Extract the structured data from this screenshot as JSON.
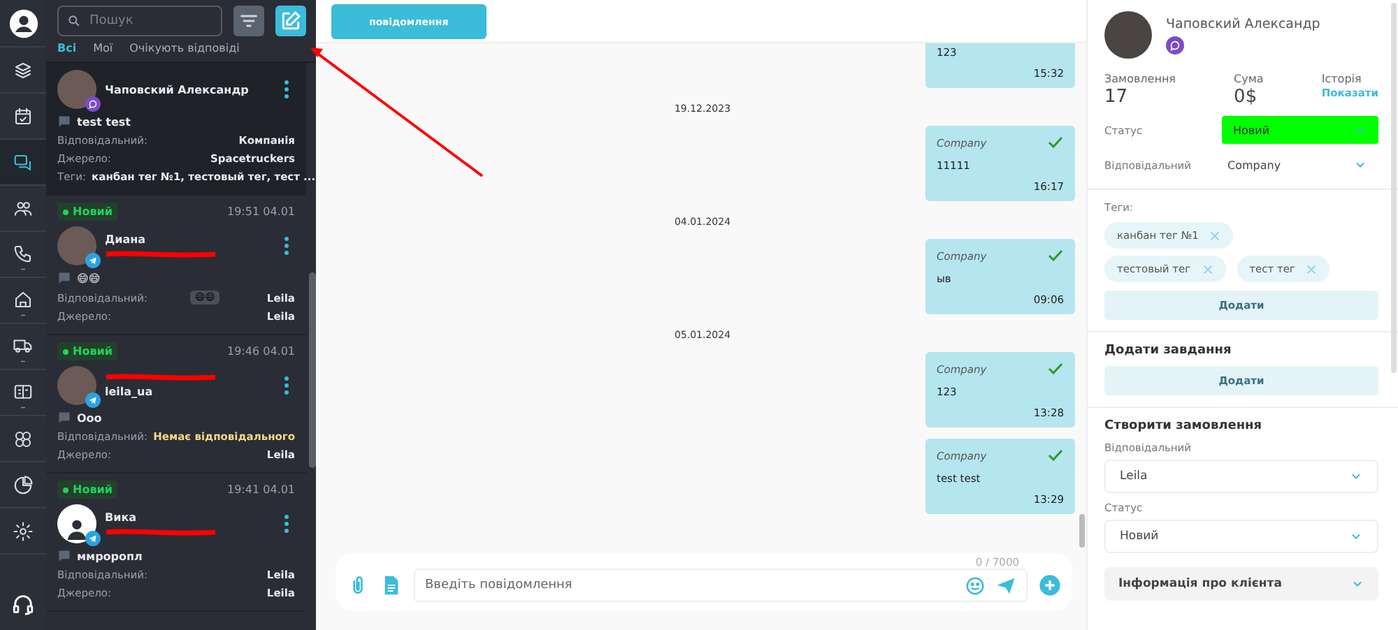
{
  "rail": {
    "items": [
      {
        "selected": false,
        "expandable": false
      },
      {
        "selected": false,
        "expandable": false
      },
      {
        "selected": true,
        "expandable": false
      },
      {
        "selected": false,
        "expandable": false
      },
      {
        "selected": false,
        "expandable": true
      },
      {
        "selected": false,
        "expandable": true
      },
      {
        "selected": false,
        "expandable": true
      },
      {
        "selected": false,
        "expandable": true
      },
      {
        "selected": false,
        "expandable": false
      },
      {
        "selected": false,
        "expandable": false
      },
      {
        "selected": false,
        "expandable": false
      }
    ]
  },
  "search": {
    "placeholder": "Пошук"
  },
  "tabs": [
    {
      "label": "Всі",
      "selected": true
    },
    {
      "label": "Мої",
      "selected": false
    },
    {
      "label": "Очікують відповіді",
      "selected": false
    }
  ],
  "conversations": [
    {
      "selected": true,
      "kind": "viber",
      "name_lines": [
        {
          "kind": "text",
          "text": "Чаповский Александр"
        }
      ],
      "preview": "test test",
      "fields": [
        {
          "label": "Відповідальний:",
          "value": "Компанія",
          "warning": false
        },
        {
          "label": "Джерело:",
          "value": "Spacetruckers",
          "warning": false
        },
        {
          "label": "Теги:",
          "value": "канбан тег №1, тестовый тег, тест ...",
          "warning": false
        }
      ]
    },
    {
      "selected": false,
      "kind": "telegram",
      "status": "Новий",
      "time": "19:51 04.01",
      "name_lines": [
        {
          "kind": "text",
          "text": "Диана"
        },
        {
          "kind": "redacted"
        }
      ],
      "preview": "😄😄",
      "fields": [
        {
          "label": "Відповідальний:",
          "badge": "😄😄",
          "value": "Leila",
          "warning": false
        },
        {
          "label": "Джерело:",
          "value": "Leila",
          "warning": false
        }
      ]
    },
    {
      "selected": false,
      "kind": "telegram",
      "status": "Новий",
      "time": "19:46 04.01",
      "name_lines": [
        {
          "kind": "redacted"
        },
        {
          "kind": "text",
          "text": "leila_ua"
        }
      ],
      "preview": "Ооо",
      "fields": [
        {
          "label": "Відповідальний:",
          "value": "Немає відповідального",
          "warning": true
        },
        {
          "label": "Джерело:",
          "value": "Leila",
          "warning": false
        }
      ]
    },
    {
      "selected": false,
      "kind": "telegram",
      "status": "Новий",
      "time": "19:41 04.01",
      "name_lines": [
        {
          "kind": "text",
          "text": "Вика"
        },
        {
          "kind": "redacted"
        }
      ],
      "preview": "ммроропл",
      "fields": [
        {
          "label": "Відповідальний:",
          "value": "Leila",
          "warning": false
        },
        {
          "label": "Джерело:",
          "value": "Leila",
          "warning": false
        }
      ]
    }
  ],
  "chat": {
    "header_button": "повідомлення",
    "items": [
      {
        "kind": "message",
        "text": "123",
        "time": "15:32",
        "delivered": false
      },
      {
        "kind": "date",
        "text": "19.12.2023"
      },
      {
        "kind": "message",
        "sender": "Company",
        "text": "11111",
        "time": "16:17",
        "delivered": true
      },
      {
        "kind": "date",
        "text": "04.01.2024"
      },
      {
        "kind": "message",
        "sender": "Company",
        "text": "ыв",
        "time": "09:06",
        "delivered": true
      },
      {
        "kind": "date",
        "text": "05.01.2024"
      },
      {
        "kind": "message",
        "sender": "Company",
        "text": "123",
        "time": "13:28",
        "delivered": true
      },
      {
        "kind": "message",
        "sender": "Company",
        "text": "test test",
        "time": "13:29",
        "delivered": true
      }
    ],
    "counter": "0 / 7000",
    "placeholder": "Введіть повідомлення"
  },
  "contact": {
    "name": "Чаповский Александр",
    "kind": "viber",
    "stats": [
      {
        "label": "Замовлення",
        "value": "17",
        "kind": "number"
      },
      {
        "label": "Сума",
        "value": "0$",
        "kind": "number"
      },
      {
        "label": "Історія",
        "value": "Показати",
        "kind": "link"
      }
    ],
    "status": {
      "label": "Статус",
      "value": "Новий",
      "color": "#00ff00"
    },
    "responsible": {
      "label": "Відповідальний",
      "value": "Company"
    },
    "tags_label": "Теги:",
    "tags": [
      "канбан тег №1",
      "тестовый тег",
      "тест тег"
    ],
    "tags_button": "Додати",
    "task": {
      "title": "Додати завдання",
      "button": "Додати"
    },
    "order": {
      "title": "Створити замовлення",
      "responsible_label": "Відповідальний",
      "responsible": "Leila",
      "status_label": "Статус",
      "status": "Новий"
    },
    "client_info": {
      "title": "Інформація про клієнта",
      "expanded": false
    }
  },
  "annotation": {
    "arrow": true
  }
}
